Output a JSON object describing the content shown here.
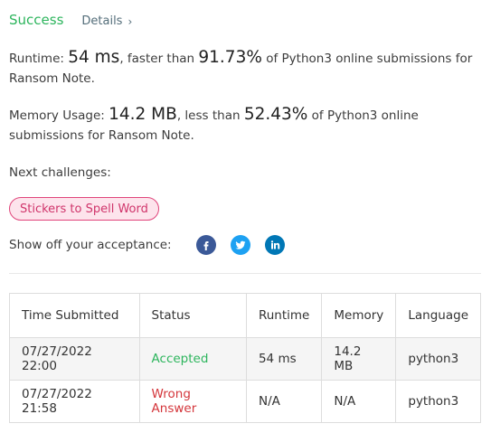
{
  "header": {
    "status": "Success",
    "details_label": "Details",
    "details_icon": "chevron-right-icon"
  },
  "runtime": {
    "label": "Runtime:",
    "value": "54 ms",
    "mid_text": ", faster than",
    "percent": "91.73%",
    "tail_text": "of Python3 online submissions for Ransom Note."
  },
  "memory": {
    "label": "Memory Usage:",
    "value": "14.2 MB",
    "mid_text": ", less than",
    "percent": "52.43%",
    "tail_text": "of Python3 online submissions for Ransom Note."
  },
  "next_challenges": {
    "label": "Next challenges:",
    "items": [
      "Stickers to Spell Word"
    ]
  },
  "share": {
    "label": "Show off your acceptance:",
    "icons": [
      "facebook-icon",
      "twitter-icon",
      "linkedin-icon"
    ]
  },
  "colors": {
    "success": "#2db55d",
    "wrong": "#d4363b",
    "chip_border": "#e0457b",
    "chip_bg": "#fde4ec"
  },
  "submissions": {
    "headers": [
      "Time Submitted",
      "Status",
      "Runtime",
      "Memory",
      "Language"
    ],
    "rows": [
      [
        "07/27/2022 22:00",
        "Accepted",
        "54 ms",
        "14.2 MB",
        "python3"
      ],
      [
        "07/27/2022 21:58",
        "Wrong Answer",
        "N/A",
        "N/A",
        "python3"
      ]
    ]
  }
}
